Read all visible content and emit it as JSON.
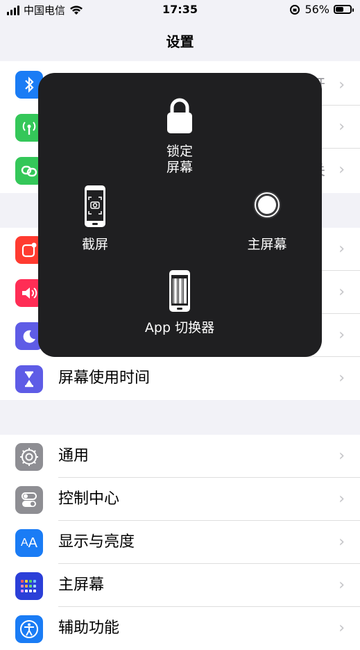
{
  "status_bar": {
    "carrier": "中国电信",
    "time": "17:35",
    "battery_percent": "56%",
    "battery_level": 0.56
  },
  "nav": {
    "title": "设置"
  },
  "partial_rows_under_overlay": {
    "row1_tail": "开",
    "row3_tail": "关"
  },
  "overlay_menu": {
    "lock_screen_line1": "锁定",
    "lock_screen_line2": "屏幕",
    "screenshot": "截屏",
    "home": "主屏幕",
    "app_switcher": "App 切换器"
  },
  "groups": {
    "screen_time": {
      "label": "屏幕使用时间"
    },
    "general_items": [
      {
        "label": "通用",
        "icon": "gear-icon",
        "color": "#8e8e93"
      },
      {
        "label": "控制中心",
        "icon": "toggle-icon",
        "color": "#8e8e93"
      },
      {
        "label": "显示与亮度",
        "icon": "aa-icon",
        "color": "#1a7cf5"
      },
      {
        "label": "主屏幕",
        "icon": "grid-icon",
        "color": "#2b5ce8"
      },
      {
        "label": "辅助功能",
        "icon": "accessibility-icon",
        "color": "#1a7cf5"
      }
    ]
  },
  "colors": {
    "bluetooth": "#1a7cf5",
    "cellular": "#34c759",
    "hotspot": "#34c759",
    "notifications": "#ff3b30",
    "sounds": "#ff2d55",
    "focus": "#5e5ce6",
    "screen_time": "#5e5ce6"
  }
}
